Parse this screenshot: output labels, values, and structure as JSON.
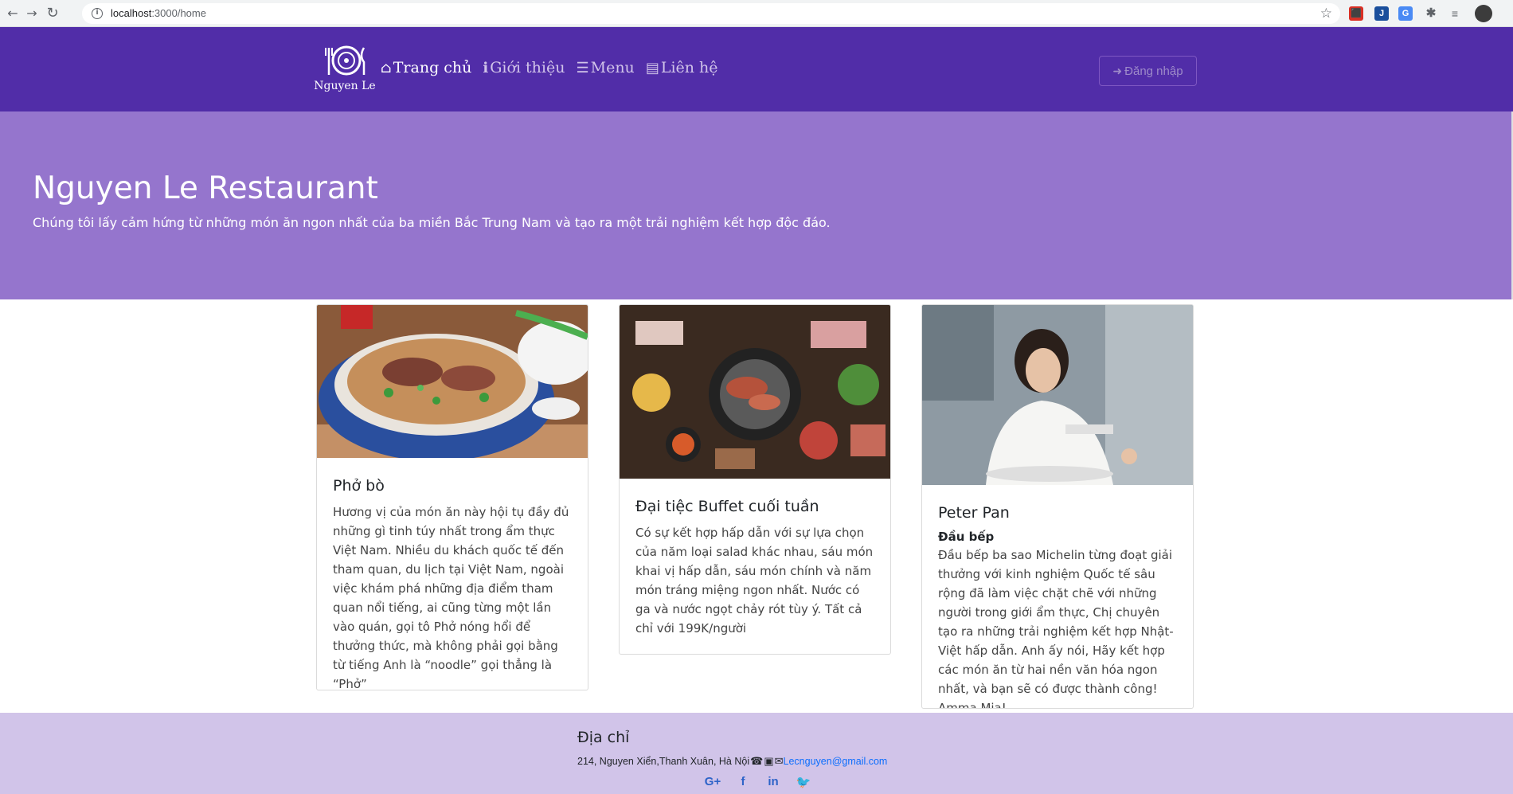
{
  "browser": {
    "url_host": "localhost",
    "url_path": ":3000/home",
    "back_icon": "arrow-left-icon",
    "forward_icon": "arrow-right-icon",
    "reload_icon": "reload-icon"
  },
  "nav": {
    "brand": "Nguyen Le",
    "links": [
      {
        "label": "Trang chủ",
        "icon": "home-icon"
      },
      {
        "label": "Giới thiệu",
        "icon": "info-icon"
      },
      {
        "label": "Menu",
        "icon": "list-icon"
      },
      {
        "label": "Liên hệ",
        "icon": "address-card-icon"
      }
    ],
    "login": "Đăng nhập"
  },
  "hero": {
    "title": "Nguyen Le Restaurant",
    "subtitle": "Chúng tôi lấy cảm hứng từ những món ăn ngon nhất của ba miền Bắc Trung Nam và tạo ra một trải nghiệm kết hợp độc đáo."
  },
  "cards": [
    {
      "title": "Phở bò",
      "text": "Hương vị của món ăn này hội tụ đầy đủ những gì tinh túy nhất trong ẩm thực Việt Nam. Nhiều du khách quốc tế đến tham quan, du lịch tại Việt Nam, ngoài việc khám phá những địa điểm tham quan nổi tiếng, ai cũng từng một lần vào quán, gọi tô Phở nóng hổi để thưởng thức, mà không phải gọi bằng từ tiếng Anh là “noodle” gọi thẳng là “Phở”"
    },
    {
      "title": "Đại tiệc Buffet cuối tuần",
      "text": "Có sự kết hợp hấp dẫn với sự lựa chọn của năm loại salad khác nhau, sáu món khai vị hấp dẫn, sáu món chính và năm món tráng miệng ngon nhất. Nước có ga và nước ngọt chảy rót tùy ý. Tất cả chỉ với 199K/người"
    },
    {
      "title": "Peter Pan",
      "subtitle": "Đầu bếp",
      "text": "Đầu bếp ba sao Michelin từng đoạt giải thưởng với kinh nghiệm Quốc tế sâu rộng đã làm việc chặt chẽ với những người trong giới ẩm thực, Chị chuyên tạo ra những trải nghiệm kết hợp Nhật- Việt hấp dẫn. Anh ấy nói, Hãy kết hợp các món ăn từ hai nền văn hóa ngon nhất, và bạn sẽ có được thành công! Amma Mia!"
    }
  ],
  "footer": {
    "heading": "Địa chỉ",
    "address": "214, Nguyen Xiển,Thanh Xuân, Hà Nội",
    "email": "Lecnguyen@gmail.com",
    "socials": [
      {
        "label": "G+",
        "icon": "google-plus-icon"
      },
      {
        "label": "f",
        "icon": "facebook-icon"
      },
      {
        "label": "in",
        "icon": "linkedin-icon"
      },
      {
        "label": "🐦",
        "icon": "twitter-icon"
      }
    ]
  },
  "colors": {
    "navbar": "#512da8",
    "hero": "#9575cd",
    "footer": "#d1c4e9",
    "link": "#0d6efd"
  }
}
